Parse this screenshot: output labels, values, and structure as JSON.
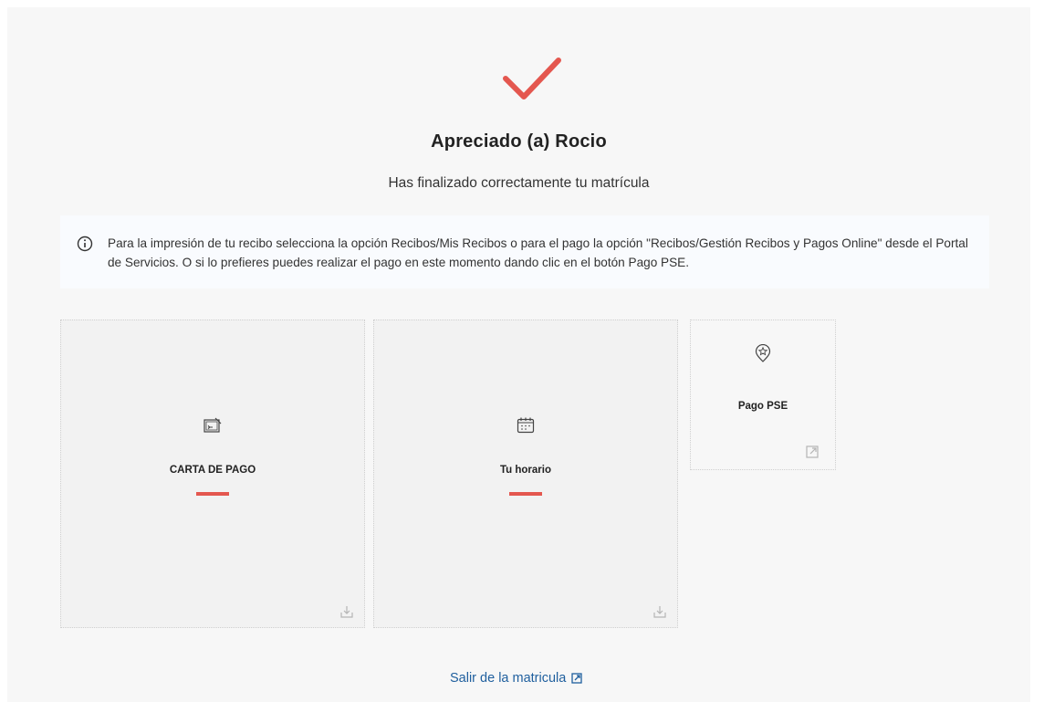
{
  "header": {
    "greeting": "Apreciado (a) Rocio",
    "message": "Has finalizado correctamente tu matrícula"
  },
  "notice": {
    "icon": "info-icon",
    "text": "Para la impresión de tu recibo selecciona la opción Recibos/Mis Recibos o para el pago la opción \"Recibos/Gestión Recibos y Pagos Online\" desde el Portal de Servicios. O si lo prefieres puedes realizar el pago en este momento dando clic en el botón Pago PSE."
  },
  "cards": [
    {
      "label": "CARTA DE PAGO",
      "icon": "payment-letter-icon",
      "action_icon": "download-icon"
    },
    {
      "label": "Tu horario",
      "icon": "calendar-icon",
      "action_icon": "download-icon"
    },
    {
      "label": "Pago PSE",
      "icon": "star-badge-icon",
      "action_icon": "external-link-icon"
    }
  ],
  "footer": {
    "exit_label": "Salir de la matricula",
    "exit_icon": "external-link-icon"
  },
  "colors": {
    "accent": "#e4574f",
    "link": "#1f5f9e",
    "background": "#f7f7f7"
  }
}
